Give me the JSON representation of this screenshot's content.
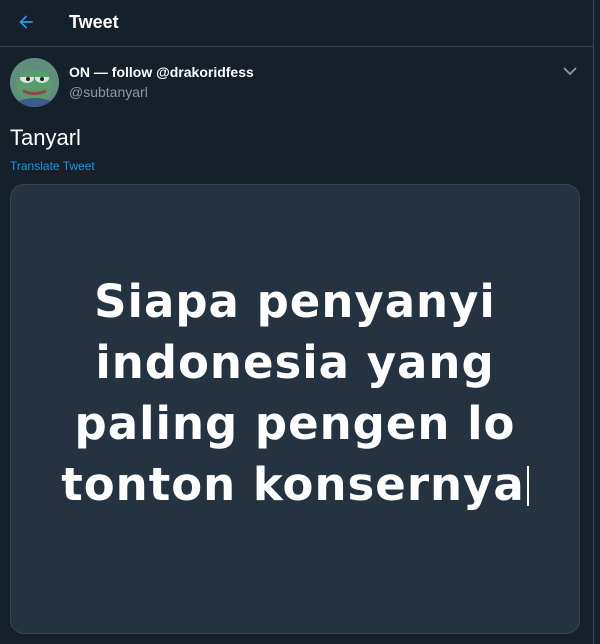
{
  "header": {
    "title": "Tweet"
  },
  "tweet": {
    "display_name": "ON — follow @drakoridfess",
    "handle": "@subtanyarl",
    "text": "Tanyarl",
    "translate_label": "Translate Tweet",
    "media": {
      "lines": [
        "Siapa penyanyi",
        "indonesia yang",
        "paling pengen lo",
        "tonton konsernya"
      ]
    }
  },
  "icons": {
    "back": "back-arrow-icon",
    "caret": "chevron-down-icon"
  },
  "colors": {
    "background": "#15202b",
    "accent": "#1da1f2",
    "link": "#1b95e0",
    "muted": "#8899a6",
    "border": "#38444d",
    "media_bg": "#253341"
  }
}
